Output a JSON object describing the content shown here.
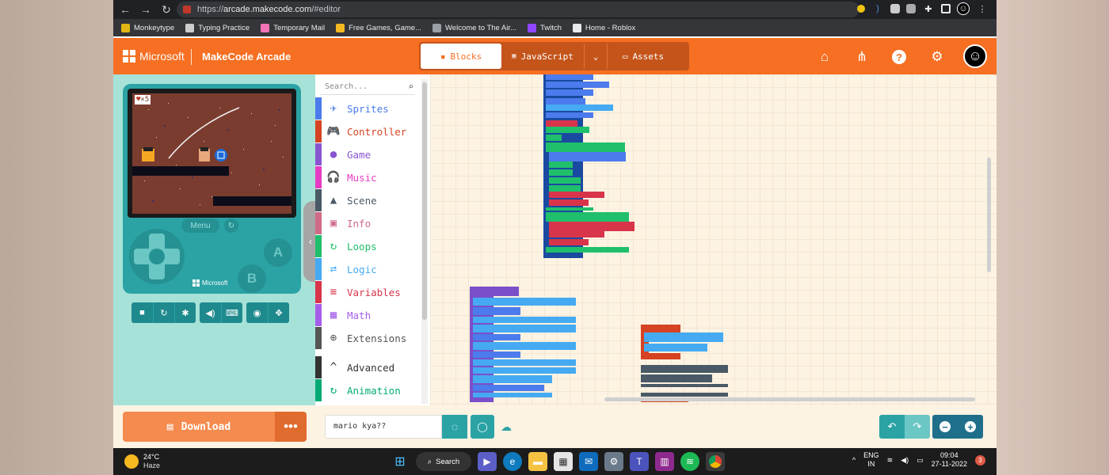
{
  "browser": {
    "url_scheme": "https://",
    "url_host": "arcade.makecode.com",
    "url_path": "/#editor"
  },
  "bookmarks": [
    {
      "label": "Monkeytype",
      "color": "#e2b714"
    },
    {
      "label": "Typing Practice",
      "color": "#cccccc"
    },
    {
      "label": "Temporary Mail",
      "color": "#f472b6"
    },
    {
      "label": "Free Games, Game...",
      "color": "#f5b820"
    },
    {
      "label": "Welcome to The Air...",
      "color": "#9aa0a6"
    },
    {
      "label": "Twitch",
      "color": "#9146ff"
    },
    {
      "label": "Home - Roblox",
      "color": "#e8eaed"
    }
  ],
  "header": {
    "brand": "Microsoft",
    "app_title": "MakeCode Arcade",
    "tabs": {
      "blocks": "Blocks",
      "javascript": "JavaScript",
      "assets": "Assets"
    },
    "accent_color": "#f66f22"
  },
  "simulator": {
    "lives_count": "5",
    "menu_label": "Menu",
    "btn_a": "A",
    "btn_b": "B",
    "brand": "Microsoft"
  },
  "toolbox": {
    "search_placeholder": "Search...",
    "categories": [
      {
        "label": "Sprites",
        "color": "#4b7bec",
        "icon": "✈"
      },
      {
        "label": "Controller",
        "color": "#d54322",
        "icon": "🎮"
      },
      {
        "label": "Game",
        "color": "#8854d0",
        "icon": "●"
      },
      {
        "label": "Music",
        "color": "#e63cc3",
        "icon": "🎧"
      },
      {
        "label": "Scene",
        "color": "#4a5966",
        "icon": "▲"
      },
      {
        "label": "Info",
        "color": "#cf6a87",
        "icon": "▣"
      },
      {
        "label": "Loops",
        "color": "#20bf6b",
        "icon": "↻"
      },
      {
        "label": "Logic",
        "color": "#45aaf2",
        "icon": "⇄"
      },
      {
        "label": "Variables",
        "color": "#d8344a",
        "icon": "≡"
      },
      {
        "label": "Math",
        "color": "#a55eea",
        "icon": "▦"
      },
      {
        "label": "Extensions",
        "color": "#555555",
        "icon": "⊕"
      },
      {
        "label": "Advanced",
        "color": "#333333",
        "icon": "^"
      },
      {
        "label": "Animation",
        "color": "#03aa74",
        "icon": "↻"
      }
    ]
  },
  "bottom": {
    "download_label": "Download",
    "project_name": "mario kya??"
  },
  "taskbar": {
    "temperature": "24°C",
    "condition": "Haze",
    "search_label": "Search",
    "lang_top": "ENG",
    "lang_bottom": "IN",
    "time": "09:04",
    "date": "27-11-2022",
    "notifications": "3"
  }
}
